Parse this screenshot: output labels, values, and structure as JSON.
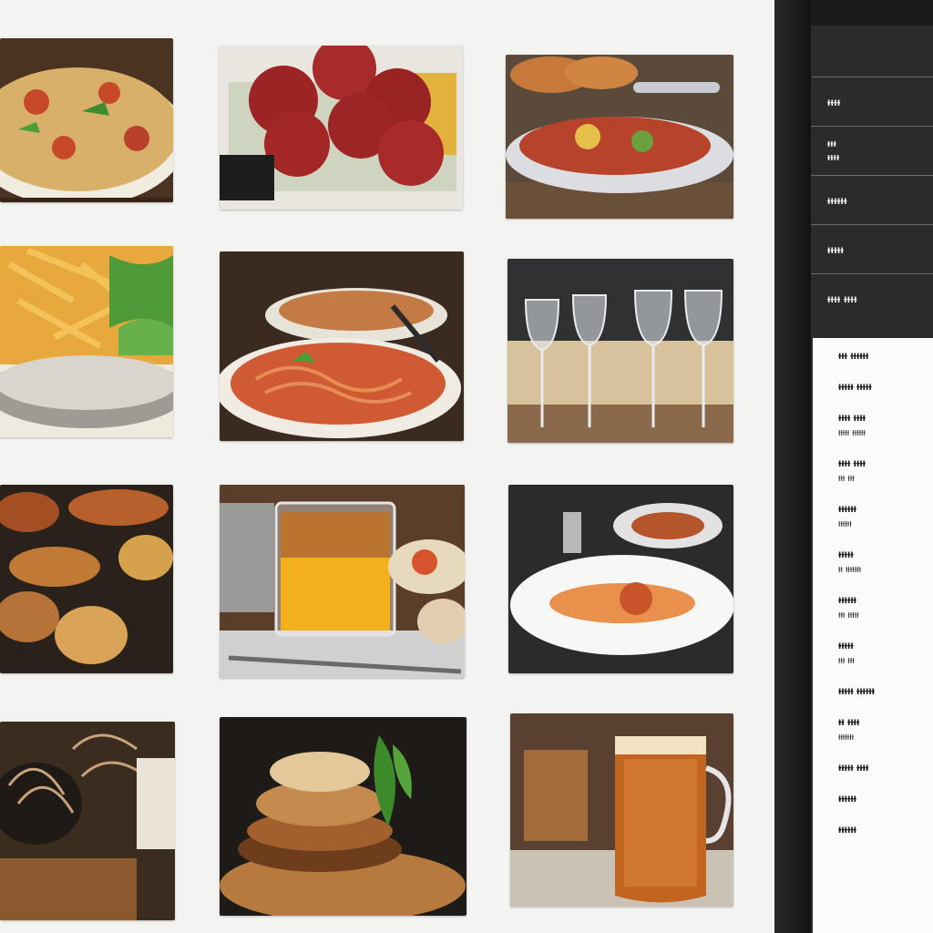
{
  "sidebar": {
    "menu": [
      {
        "label": "ᵻᵻᵻᵻ",
        "sub": ""
      },
      {
        "label": "ᵻᵻᵻ",
        "sub": "ᵻᵻᵻᵻ"
      },
      {
        "label": "ᵻᵻᵻᵻᵻᵻ",
        "sub": ""
      },
      {
        "label": "ᵻᵻᵻᵻᵻ",
        "sub": ""
      },
      {
        "label": "ᵻᵻᵻᵻ ᵻᵻᵻᵻ",
        "sub": ""
      }
    ],
    "list": [
      {
        "l1": "ᵻᵻᵻ ᵻᵻᵻᵻᵻᵻ",
        "l2": ""
      },
      {
        "l1": "ᵻᵻᵻᵻᵻ ᵻᵻᵻᵻᵻ",
        "l2": ""
      },
      {
        "l1": "ᵻᵻᵻᵻ ᵻᵻᵻᵻ",
        "l2": "ᵻᵻᵻᵻᵻ ᵻᵻᵻᵻᵻᵻ"
      },
      {
        "l1": "ᵻᵻᵻᵻ ᵻᵻᵻᵻ",
        "l2": "ᵻᵻᵻ ᵻᵻᵻ"
      },
      {
        "l1": "ᵻᵻᵻᵻᵻᵻ",
        "l2": "ᵻᵻᵻᵻᵻᵻ"
      },
      {
        "l1": "ᵻᵻᵻᵻᵻ",
        "l2": "ᵻᵻ ᵻᵻᵻᵻᵻᵻᵻ"
      },
      {
        "l1": "ᵻᵻᵻᵻᵻᵻ",
        "l2": "ᵻᵻᵻ ᵻᵻᵻᵻᵻ"
      },
      {
        "l1": "ᵻᵻᵻᵻᵻ",
        "l2": "ᵻᵻᵻ ᵻᵻᵻ"
      },
      {
        "l1": "ᵻᵻᵻᵻᵻ ᵻᵻᵻᵻᵻᵻ",
        "l2": ""
      },
      {
        "l1": "ᵻᵻ ᵻᵻᵻᵻ",
        "l2": "ᵻᵻᵻᵻᵻᵻᵻ"
      },
      {
        "l1": "ᵻᵻᵻᵻᵻ ᵻᵻᵻᵻ",
        "l2": ""
      },
      {
        "l1": "ᵻᵻᵻᵻᵻᵻ",
        "l2": ""
      },
      {
        "l1": "ᵻᵻᵻᵻᵻᵻ",
        "l2": ""
      }
    ]
  },
  "gallery": {
    "photos": [
      "pizza-photo",
      "salami-fries-photo",
      "seafood-plate-photo",
      "fries-salad-photo",
      "pasta-bowls-photo",
      "wine-glasses-photo",
      "roasted-wings-photo",
      "orange-juice-photo",
      "plated-dish-photo",
      "noodles-photo",
      "burger-photo",
      "beer-mug-photo"
    ]
  }
}
